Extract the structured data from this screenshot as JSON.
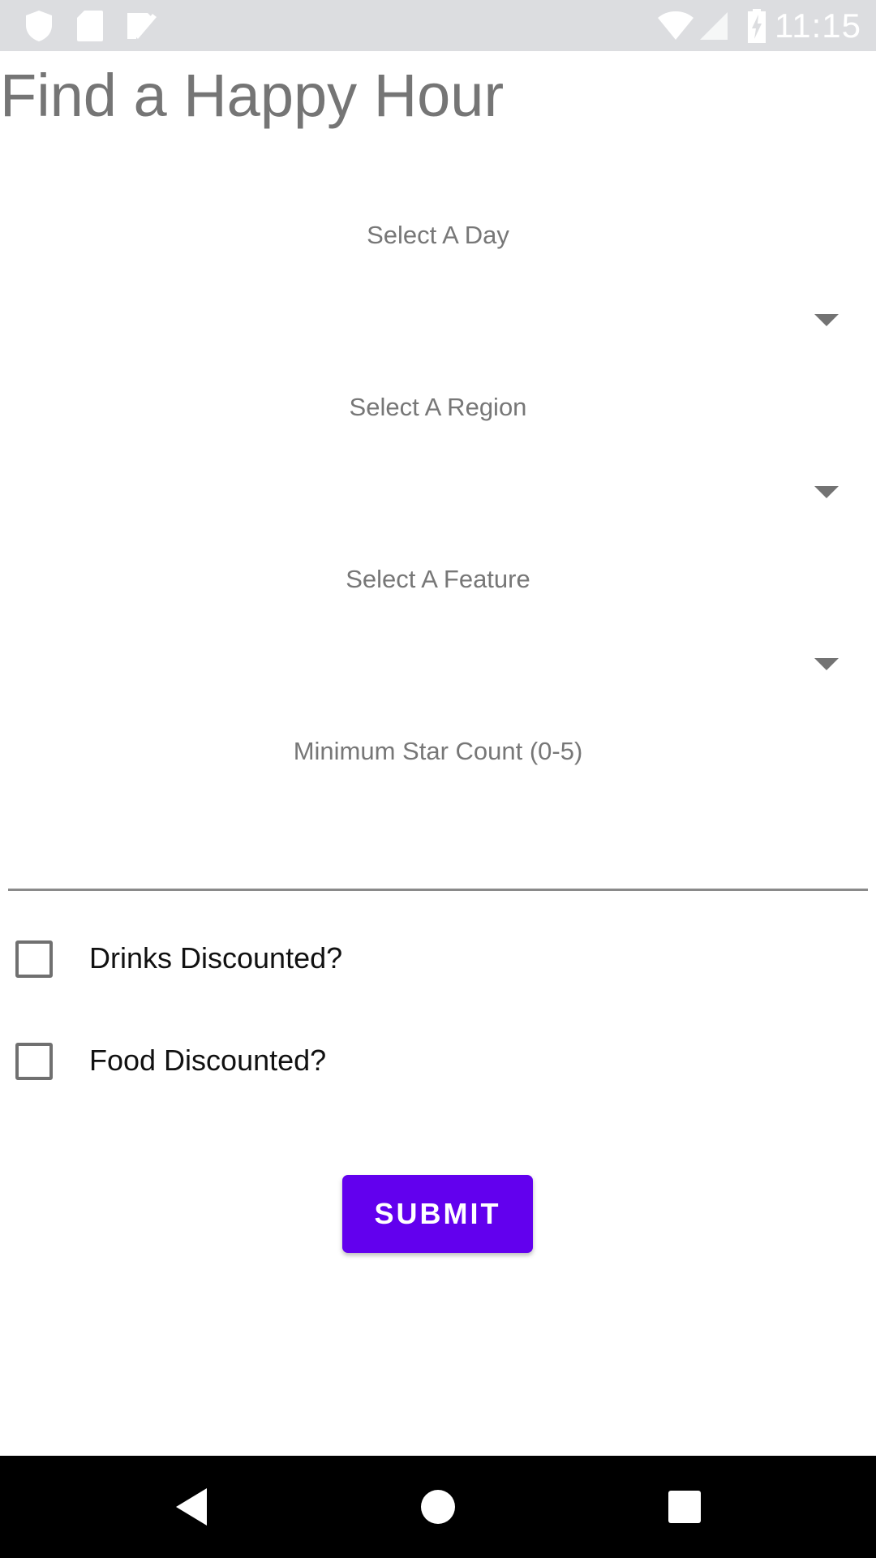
{
  "status_bar": {
    "time": "11:15",
    "left_icons": [
      "shield-icon",
      "sd-card-icon",
      "tasks-check-icon"
    ],
    "right_icons": [
      "wifi-icon",
      "signal-icon",
      "battery-charging-icon"
    ]
  },
  "page": {
    "title": "Find a Happy Hour"
  },
  "form": {
    "day_label": "Select A Day",
    "region_label": "Select A Region",
    "feature_label": "Select A Feature",
    "star_label": "Minimum Star Count (0-5)",
    "star_value": "",
    "drinks_label": "Drinks Discounted?",
    "drinks_checked": false,
    "food_label": "Food Discounted?",
    "food_checked": false,
    "submit_label": "SUBMIT"
  },
  "colors": {
    "accent": "#6200ee",
    "status_bar": "#dcdde0",
    "nav_bar": "#000000",
    "label_text": "#777777"
  },
  "nav_bar": {
    "icons": [
      "back-icon",
      "home-icon",
      "recents-icon"
    ]
  }
}
